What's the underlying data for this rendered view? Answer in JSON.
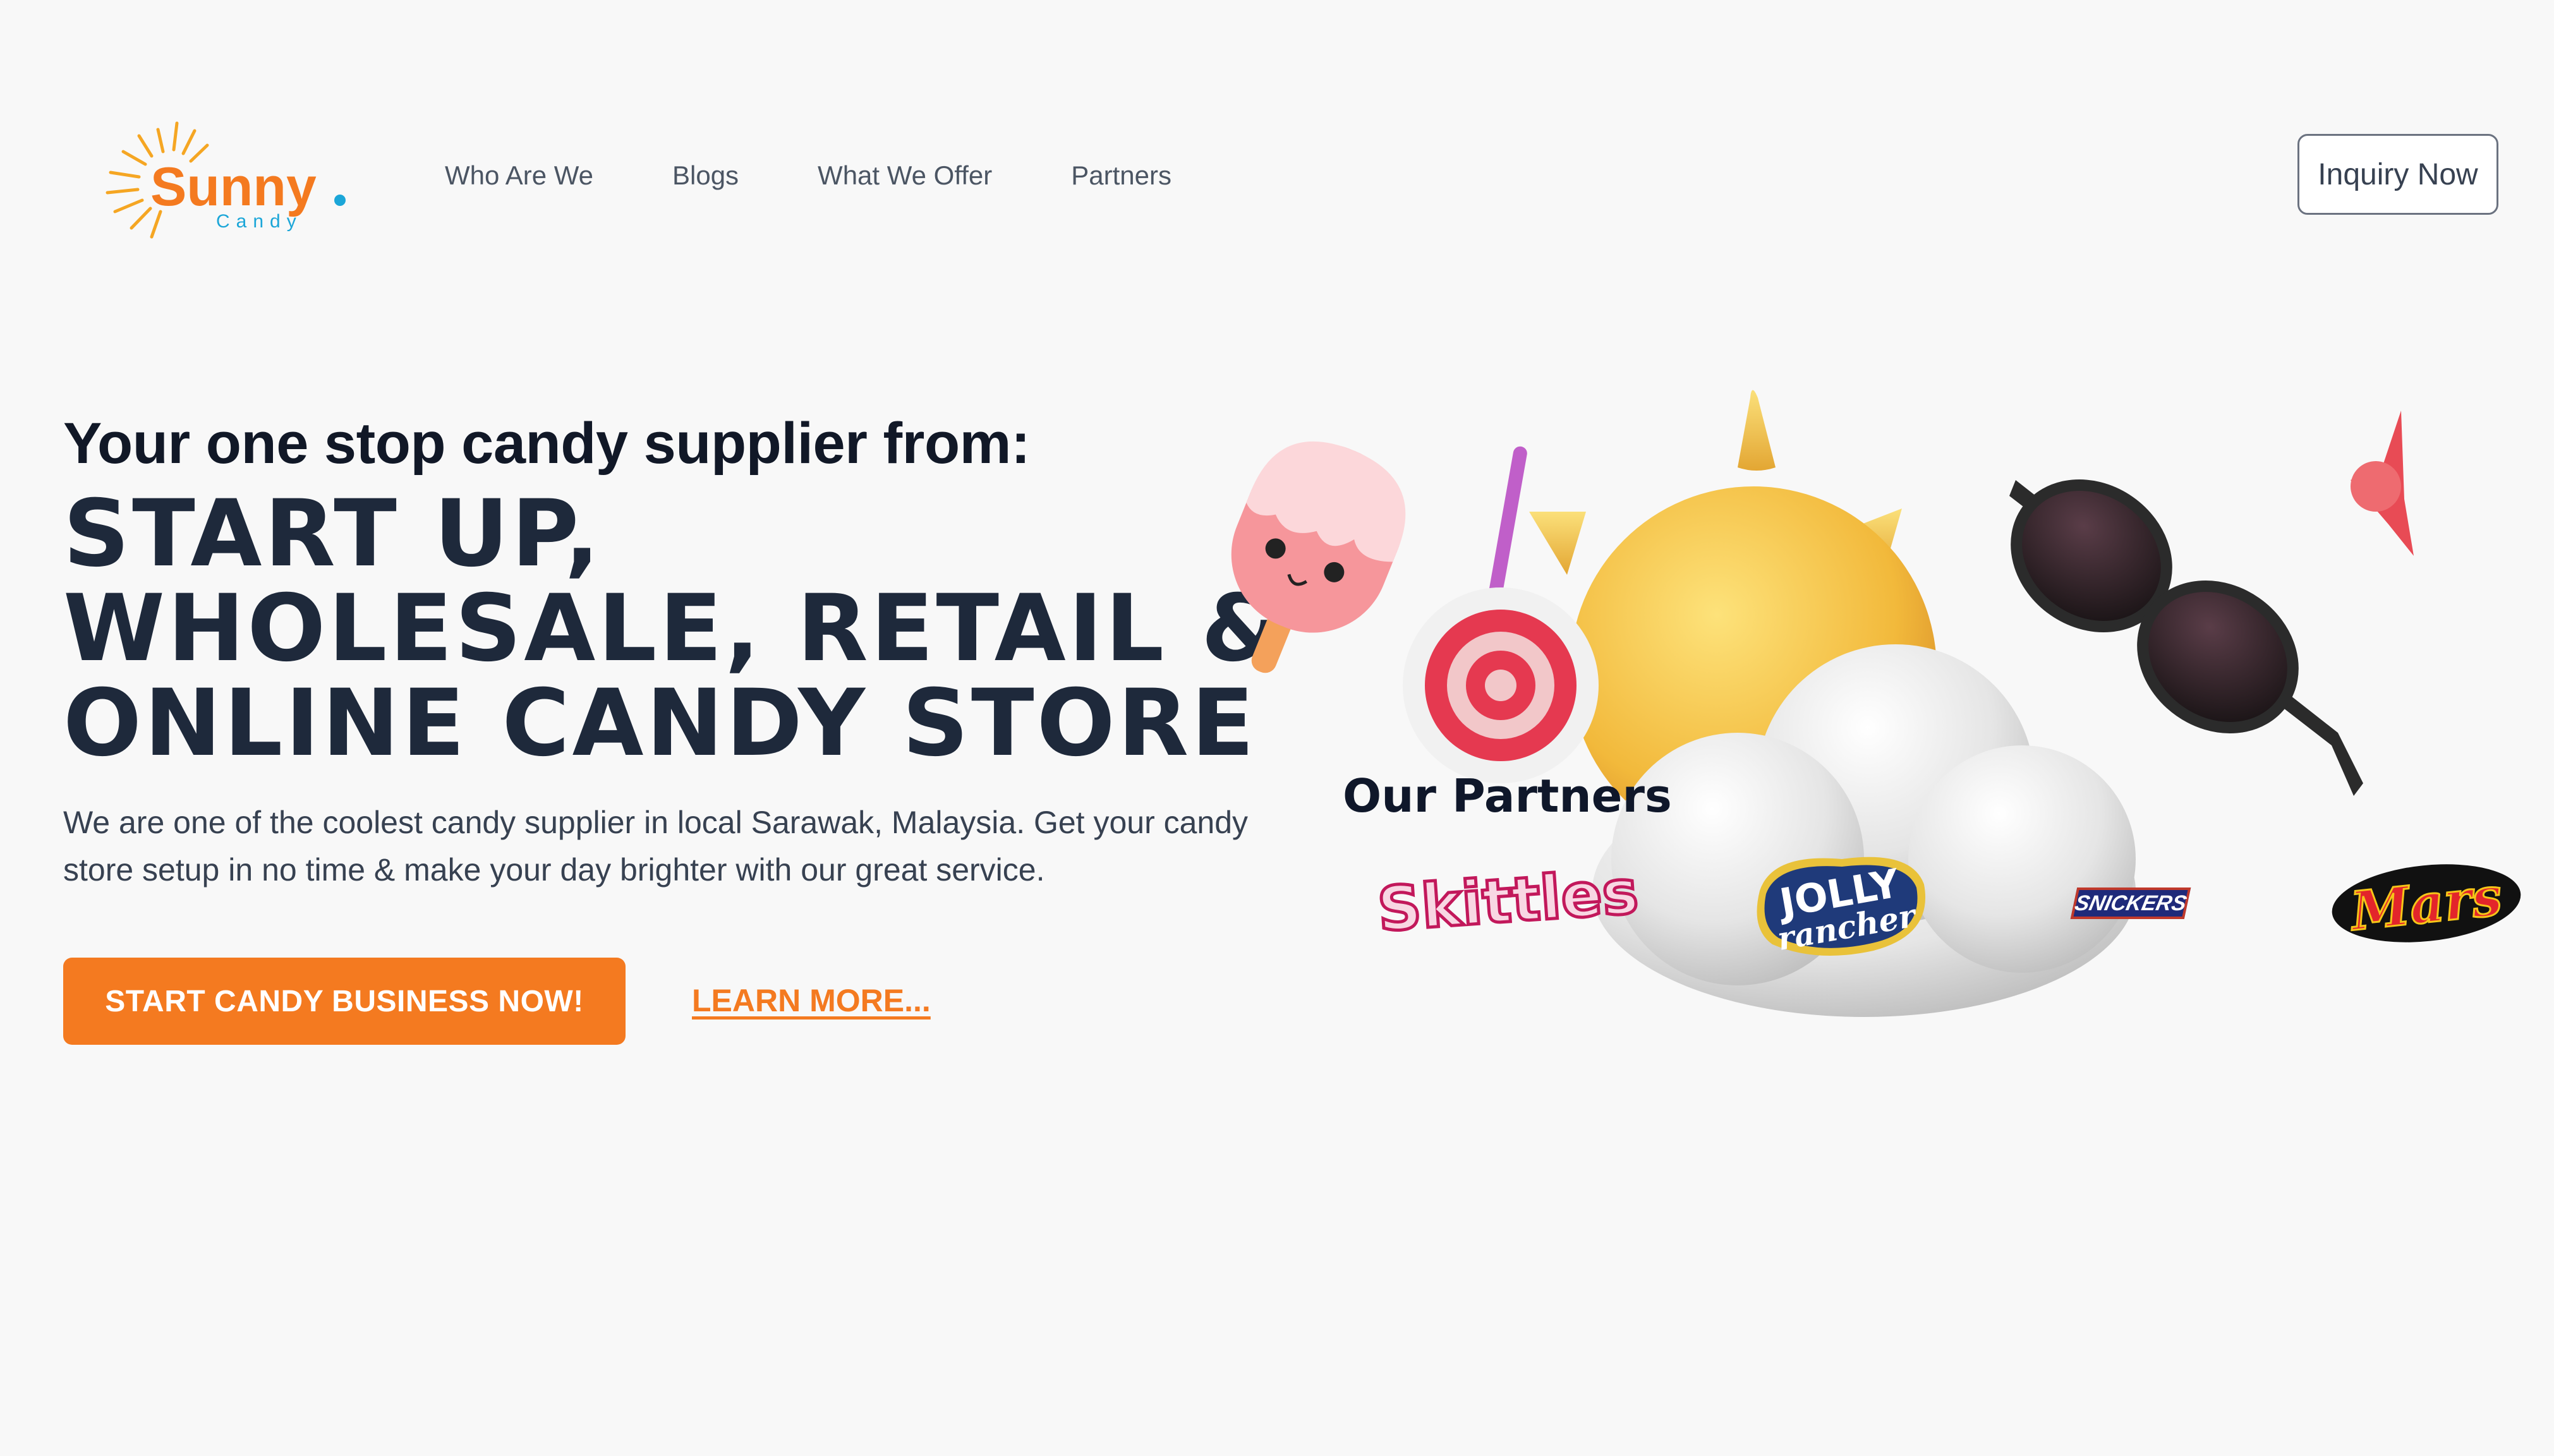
{
  "brand": {
    "name": "Sunny",
    "dot": ".",
    "tagline": "Candy",
    "colors": {
      "orange": "#f47a20",
      "sun": "#f5a623",
      "blue": "#1ba6d8"
    }
  },
  "nav": {
    "items": [
      {
        "label": "Who Are We"
      },
      {
        "label": "Blogs"
      },
      {
        "label": "What We Offer"
      },
      {
        "label": "Partners"
      }
    ],
    "inquiry_label": "Inquiry Now"
  },
  "hero": {
    "subtitle": "Your one stop candy supplier from:",
    "title_lines": [
      "START UP,",
      "WHOLESALE, RETAIL &",
      "ONLINE CANDY STORE"
    ],
    "description": "We are one of the coolest candy supplier in local Sarawak, Malaysia. Get your candy store setup in no time & make your day brighter with our great service.",
    "cta_label": "START CANDY BUSINESS NOW!",
    "learn_more_label": "LEARN MORE..."
  },
  "partners": {
    "title": "Our Partners",
    "logos": [
      {
        "name": "skittles-logo",
        "text": "Skittles"
      },
      {
        "name": "jolly-rancher-logo",
        "text": "JOLLY rancher"
      },
      {
        "name": "snickers-logo",
        "text": "SNICKERS"
      },
      {
        "name": "mars-logo",
        "text": "Mars"
      }
    ]
  },
  "illustration": {
    "elements": [
      "ice-pop-icon",
      "lollipop-icon",
      "sun-icon",
      "cloud-icon",
      "sunglasses-icon",
      "candy-spike-icon"
    ]
  }
}
